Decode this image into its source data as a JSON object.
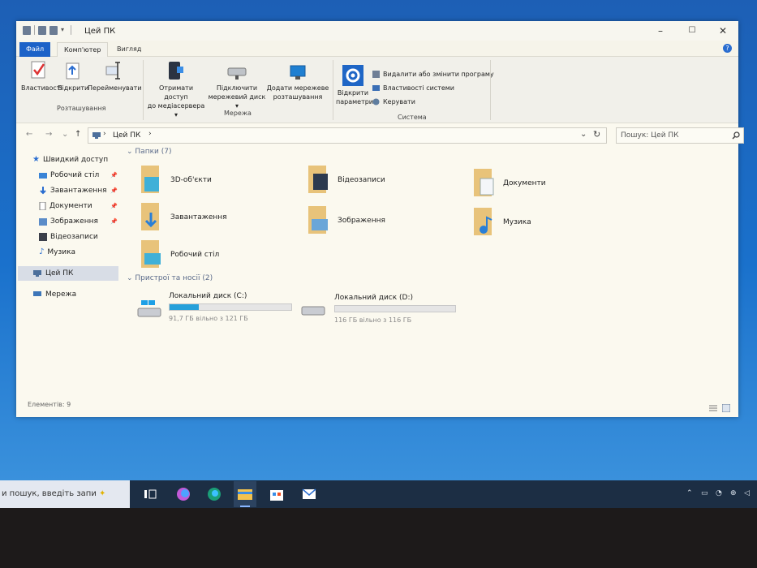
{
  "window": {
    "title": "Цей ПК",
    "controls": [
      "–",
      "☐",
      "✕"
    ]
  },
  "tabs": {
    "file": "Файл",
    "computer": "Комп'ютер",
    "view": "Вигляд",
    "help": "?"
  },
  "ribbon": {
    "location": {
      "properties": "Властивості",
      "open": "Відкрити",
      "rename": "Перейменувати",
      "group": "Розташування"
    },
    "network": {
      "media_line1": "Отримати доступ",
      "media_line2": "до медіасервера ▾",
      "map_line1": "Підключити",
      "map_line2": "мережевий диск ▾",
      "add_line1": "Додати мережеве",
      "add_line2": "розташування",
      "group": "Мережа"
    },
    "system": {
      "settings_line1": "Відкрити",
      "settings_line2": "параметри",
      "uninstall": "Видалити або змінити програму",
      "sysprops": "Властивості системи",
      "manage": "Керувати",
      "group": "Система"
    }
  },
  "address": {
    "back": "←",
    "forward": "→",
    "recent": "⌄",
    "up": "↑",
    "path": "Цей ПК",
    "chevron": "›",
    "dropdown": "⌄",
    "refresh": "↻",
    "search_placeholder": "Пошук: Цей ПК"
  },
  "sidebar": {
    "quick_access": "Швидкий доступ",
    "items": [
      {
        "label": "Робочий стіл",
        "icon": "desktop-icon",
        "pinned": true
      },
      {
        "label": "Завантаження",
        "icon": "download-icon",
        "pinned": true
      },
      {
        "label": "Документи",
        "icon": "document-icon",
        "pinned": true
      },
      {
        "label": "Зображення",
        "icon": "pictures-icon",
        "pinned": true
      },
      {
        "label": "Відеозаписи",
        "icon": "videos-icon",
        "pinned": false
      },
      {
        "label": "Музика",
        "icon": "music-icon",
        "pinned": false
      }
    ],
    "this_pc": "Цей ПК",
    "network": "Мережа"
  },
  "folders_header": "Папки (7)",
  "folders": [
    {
      "name": "3D-об'єкти",
      "icon": "3d-objects-icon"
    },
    {
      "name": "Відеозаписи",
      "icon": "videos-icon"
    },
    {
      "name": "Документи",
      "icon": "document-icon"
    },
    {
      "name": "Завантаження",
      "icon": "download-icon"
    },
    {
      "name": "Зображення",
      "icon": "pictures-icon"
    },
    {
      "name": "Музика",
      "icon": "music-icon"
    },
    {
      "name": "Робочий стіл",
      "icon": "desktop-icon"
    }
  ],
  "devices_header": "Пристрої та носії (2)",
  "drives": [
    {
      "name": "Локальний диск (C:)",
      "free": "91,7 ГБ вільно з 121 ГБ",
      "used_fraction": 0.242
    },
    {
      "name": "Локальний диск (D:)",
      "free": "116 ГБ вільно з 116 ГБ",
      "used_fraction": 0.0
    }
  ],
  "status": {
    "items": "Елементів: 9"
  },
  "taskbar": {
    "search": "и пошук, введіть запи",
    "icons": [
      "task-view-icon",
      "copilot-icon",
      "edge-icon",
      "file-explorer-icon",
      "store-icon",
      "mail-icon"
    ]
  },
  "colors": {
    "accent": "#1c62c8",
    "drive_fill": "#26a0da",
    "folder": "#e8c37a",
    "taskbar": "#1c2e44"
  }
}
